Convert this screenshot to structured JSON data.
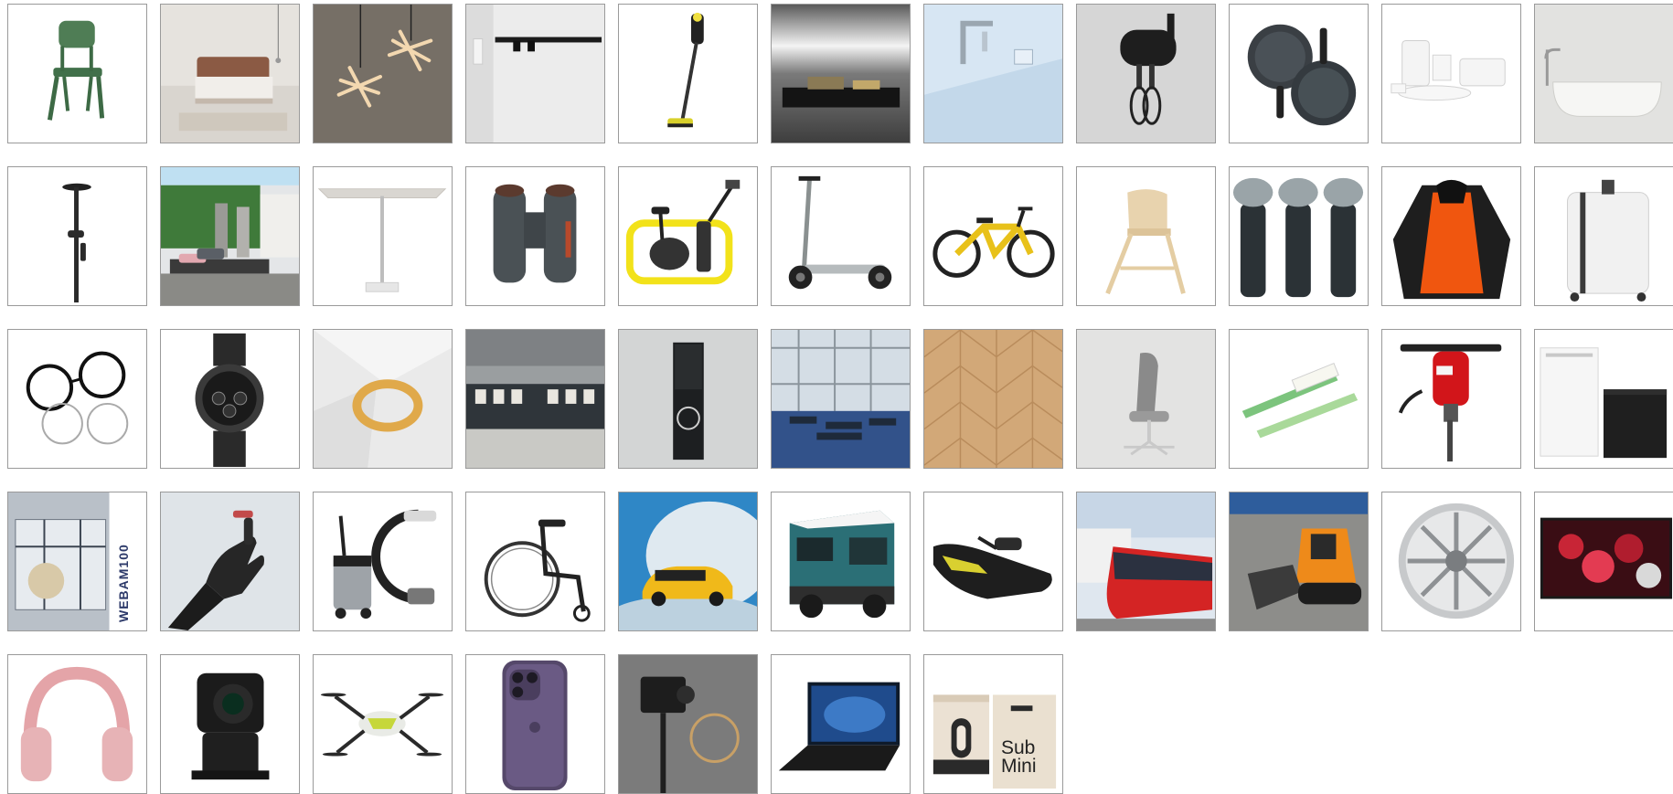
{
  "gallery": {
    "tiles": [
      {
        "icon": "chair-icon"
      },
      {
        "icon": "bed-icon"
      },
      {
        "icon": "pendant-lamp-icon"
      },
      {
        "icon": "track-light-icon"
      },
      {
        "icon": "vacuum-icon"
      },
      {
        "icon": "kitchen-island-icon"
      },
      {
        "icon": "faucet-icon"
      },
      {
        "icon": "hand-mixer-icon"
      },
      {
        "icon": "frying-pans-icon"
      },
      {
        "icon": "tableware-icon"
      },
      {
        "icon": "bathtub-icon"
      },
      {
        "icon": "shower-icon"
      },
      {
        "icon": "garden-lounger-icon"
      },
      {
        "icon": "parasol-icon"
      },
      {
        "icon": "binoculars-icon"
      },
      {
        "icon": "exercise-bike-icon"
      },
      {
        "icon": "e-scooter-icon"
      },
      {
        "icon": "e-bike-icon"
      },
      {
        "icon": "high-chair-icon"
      },
      {
        "icon": "shavers-icon"
      },
      {
        "icon": "jacket-icon"
      },
      {
        "icon": "suitcase-icon"
      },
      {
        "icon": "glasses-icon"
      },
      {
        "icon": "watch-icon"
      },
      {
        "icon": "bracelet-icon"
      },
      {
        "icon": "store-interior-icon"
      },
      {
        "icon": "door-station-icon"
      },
      {
        "icon": "airport-lounge-icon"
      },
      {
        "icon": "parquet-floor-icon"
      },
      {
        "icon": "office-chair-icon"
      },
      {
        "icon": "pens-icon"
      },
      {
        "icon": "jackhammer-icon"
      },
      {
        "icon": "heat-pump-icon"
      },
      {
        "icon": "factory-machine-icon",
        "label": "WEBAM100"
      },
      {
        "icon": "robot-hand-icon"
      },
      {
        "icon": "c-arm-icon"
      },
      {
        "icon": "wheelchair-icon"
      },
      {
        "icon": "car-icon"
      },
      {
        "icon": "camper-van-icon"
      },
      {
        "icon": "jet-ski-icon"
      },
      {
        "icon": "tram-icon"
      },
      {
        "icon": "skid-steer-icon"
      },
      {
        "icon": "alloy-wheel-icon"
      },
      {
        "icon": "tv-icon"
      },
      {
        "icon": "headphones-icon"
      },
      {
        "icon": "ptz-camera-icon"
      },
      {
        "icon": "drone-icon"
      },
      {
        "icon": "smartphone-icon"
      },
      {
        "icon": "projector-icon"
      },
      {
        "icon": "laptop-icon"
      },
      {
        "icon": "subwoofer-icon",
        "label": "Sub\nMini"
      }
    ]
  },
  "colors": {
    "tile_border": "#9a9a9a",
    "background": "#ffffff"
  }
}
